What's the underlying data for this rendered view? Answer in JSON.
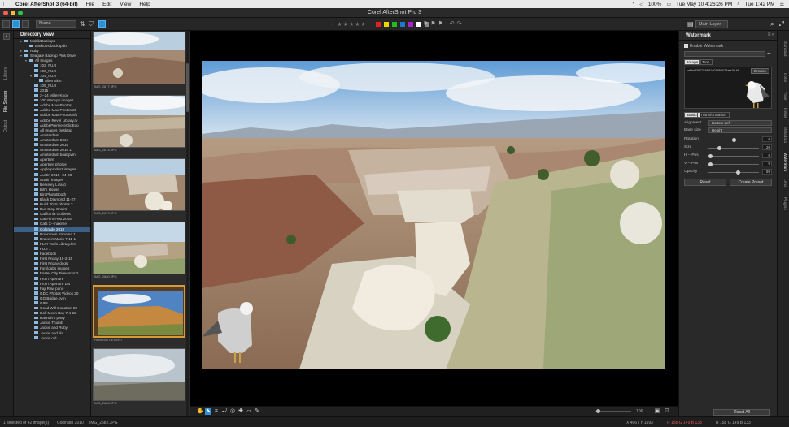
{
  "menubar": {
    "app_name": "Corel AfterShot 3 (64-bit)",
    "menus": [
      "File",
      "Edit",
      "View",
      "Help"
    ],
    "battery": "100%",
    "datetime": "Tue May 10  4:26:26 PM",
    "clock": "Tue 1:42 PM"
  },
  "window": {
    "title": "Corel AfterShot Pro 3"
  },
  "toolbar": {
    "search_placeholder": "Name",
    "stars": "• ★★★★★",
    "flags": "⚑⚑⚑ ↶↷",
    "layer_select": "Main Layer",
    "label_colors": [
      "#d22",
      "#e8d800",
      "#2b2",
      "#27c",
      "#a2c",
      "#fff",
      "#888"
    ]
  },
  "left_tabs": [
    "Library",
    "File System",
    "Output"
  ],
  "directory": {
    "title": "Directory view",
    "items": [
      {
        "label": "MobileBackups",
        "depth": 1,
        "tri": "▸"
      },
      {
        "label": "Backups.backupdb",
        "depth": 2,
        "tri": ""
      },
      {
        "label": "Ruby",
        "depth": 1,
        "tri": "▸"
      },
      {
        "label": "Seagate Backup Plus Drive",
        "depth": 1,
        "tri": "▾"
      },
      {
        "label": "All Images",
        "depth": 2,
        "tri": "▾"
      },
      {
        "label": "102_FUJI",
        "depth": 3,
        "tri": ""
      },
      {
        "label": "103_FUJI",
        "depth": 3,
        "tri": ""
      },
      {
        "label": "104_FUJI",
        "depth": 3,
        "tri": "▾"
      },
      {
        "label": "Allen Skin",
        "depth": 4,
        "tri": ""
      },
      {
        "label": "105_FUJI",
        "depth": 3,
        "tri": ""
      },
      {
        "label": "2015",
        "depth": 3,
        "tri": ""
      },
      {
        "label": "3--24 Miller-Knox",
        "depth": 3,
        "tri": ""
      },
      {
        "label": "100 startups images",
        "depth": 3,
        "tri": ""
      },
      {
        "label": "Adobe Max Photos",
        "depth": 3,
        "tri": ""
      },
      {
        "label": "Adobe Max Photos 20",
        "depth": 3,
        "tri": ""
      },
      {
        "label": "Adobe Max Photos sfo",
        "depth": 3,
        "tri": ""
      },
      {
        "label": "Adobe Revel Library.rv",
        "depth": 3,
        "tri": ""
      },
      {
        "label": "AdobePremiereClipExp",
        "depth": 3,
        "tri": ""
      },
      {
        "label": "All Images Desktop",
        "depth": 3,
        "tri": ""
      },
      {
        "label": "Amsterdam",
        "depth": 3,
        "tri": ""
      },
      {
        "label": "Amsterdam 2014",
        "depth": 3,
        "tri": ""
      },
      {
        "label": "Amsterdam 2015",
        "depth": 3,
        "tri": ""
      },
      {
        "label": "Amsterdam 2015 1",
        "depth": 3,
        "tri": ""
      },
      {
        "label": "Amsterdam boat.pvm",
        "depth": 3,
        "tri": ""
      },
      {
        "label": "Aperture",
        "depth": 3,
        "tri": ""
      },
      {
        "label": "Aperture photos",
        "depth": 3,
        "tri": ""
      },
      {
        "label": "Apple product images",
        "depth": 3,
        "tri": ""
      },
      {
        "label": "Austin 2015--04-23",
        "depth": 3,
        "tri": ""
      },
      {
        "label": "Austin images",
        "depth": 3,
        "tri": ""
      },
      {
        "label": "Berkeley Lizard",
        "depth": 3,
        "tri": ""
      },
      {
        "label": "Bill's House",
        "depth": 3,
        "tri": ""
      },
      {
        "label": "BirdPhotoBooth",
        "depth": 3,
        "tri": ""
      },
      {
        "label": "Black Diamond 11-27-",
        "depth": 3,
        "tri": ""
      },
      {
        "label": "Build 2015 photos 2",
        "depth": 3,
        "tri": ""
      },
      {
        "label": "Bus Stop Chairs",
        "depth": 3,
        "tri": ""
      },
      {
        "label": "California Goldens",
        "depth": 3,
        "tri": ""
      },
      {
        "label": "Cat Film Fest 2015",
        "depth": 3,
        "tri": ""
      },
      {
        "label": "Cats X--maxime",
        "depth": 3,
        "tri": ""
      },
      {
        "label": "Colorado 2010",
        "depth": 3,
        "tri": "",
        "selected": true
      },
      {
        "label": "Downtown Sonoma 11",
        "depth": 3,
        "tri": ""
      },
      {
        "label": "Drake in Marin 7-11-1",
        "depth": 3,
        "tri": ""
      },
      {
        "label": "FLIR Tools Library.flm",
        "depth": 3,
        "tri": ""
      },
      {
        "label": "FUJI 1",
        "depth": 3,
        "tri": ""
      },
      {
        "label": "Facebook",
        "depth": 3,
        "tri": ""
      },
      {
        "label": "First Friday 10-2-15",
        "depth": 3,
        "tri": ""
      },
      {
        "label": "First Friday dogs",
        "depth": 3,
        "tri": ""
      },
      {
        "label": "Fomldabs images",
        "depth": 3,
        "tri": ""
      },
      {
        "label": "Foster City Fireworks 2",
        "depth": 3,
        "tri": ""
      },
      {
        "label": "From Aperture",
        "depth": 3,
        "tri": ""
      },
      {
        "label": "From Aperture DB",
        "depth": 3,
        "tri": ""
      },
      {
        "label": "Fuji Raw pano",
        "depth": 3,
        "tri": ""
      },
      {
        "label": "GDC Photos Videos 20",
        "depth": 3,
        "tri": ""
      },
      {
        "label": "GG Bridge.pvm",
        "depth": 3,
        "tri": ""
      },
      {
        "label": "GIFs",
        "depth": 3,
        "tri": ""
      },
      {
        "label": "Good Will Donation 20",
        "depth": 3,
        "tri": ""
      },
      {
        "label": "Half Moon Bay 7-4-15",
        "depth": 3,
        "tri": ""
      },
      {
        "label": "Hannah's party",
        "depth": 3,
        "tri": ""
      },
      {
        "label": "Jackie Thumb",
        "depth": 3,
        "tri": ""
      },
      {
        "label": "Jackie and Ruby",
        "depth": 3,
        "tri": ""
      },
      {
        "label": "Jackie and Ilia",
        "depth": 3,
        "tri": ""
      },
      {
        "label": "Jackie old",
        "depth": 3,
        "tri": ""
      }
    ]
  },
  "filmstrip": {
    "thumbs": [
      {
        "caption": "IMG_2677.JPG",
        "kind": "canyon"
      },
      {
        "caption": "IMG_2678.JPG",
        "kind": "plain"
      },
      {
        "caption": "IMG_2679.JPG",
        "kind": "hoodoo"
      },
      {
        "caption": "IMG_2680.JPG",
        "kind": "canyon2"
      },
      {
        "caption": "PAINTED DESERT",
        "kind": "painting",
        "selected": true
      },
      {
        "caption": "IMG_2683.JPG",
        "kind": "cloudy"
      }
    ]
  },
  "viewer": {
    "zoom_value": "106"
  },
  "right_panel": {
    "title": "Watermark",
    "enable_label": "Enable Watermark",
    "tabs": [
      "Image",
      "Text"
    ],
    "file_name": "ca8bd78972c5681d01959073afa3b.tif",
    "browse_label": "Browse",
    "sub_tabs": [
      "Basic",
      "Transformation"
    ],
    "alignment_label": "Alignment",
    "alignment_value": "Bottom Left",
    "base_size_label": "Base size",
    "base_size_value": "Height",
    "rotation_label": "Rotation",
    "rotation_value": "0",
    "size_label": "Size",
    "size_value": "20",
    "hpos_label": "H -- Pos",
    "hpos_value": "0",
    "vpos_label": "V -- Pos",
    "vpos_value": "0",
    "opacity_label": "Opacity",
    "opacity_value": "59",
    "reset_label": "Reset",
    "create_preset_label": "Create Preset",
    "reset_all_label": "Reset All",
    "slider_levels": {
      "rotation": 0.5,
      "size": 0.2,
      "hpos": 0.0,
      "vpos": 0.0,
      "opacity": 0.59
    }
  },
  "right_tabs": [
    "Standard",
    "Color",
    "Tone",
    "Detail",
    "Metadata",
    "Watermark",
    "Lens",
    "Plugins"
  ],
  "status": {
    "selection": "1 selected of 42 image(s)",
    "folder": "Colorado 2010",
    "file": "IMG_2682.JPG",
    "dims": "X 4067  Y 1593",
    "rgb": "R 158  G 149  B 133",
    "channels": "R 158   G 149   B 133"
  }
}
